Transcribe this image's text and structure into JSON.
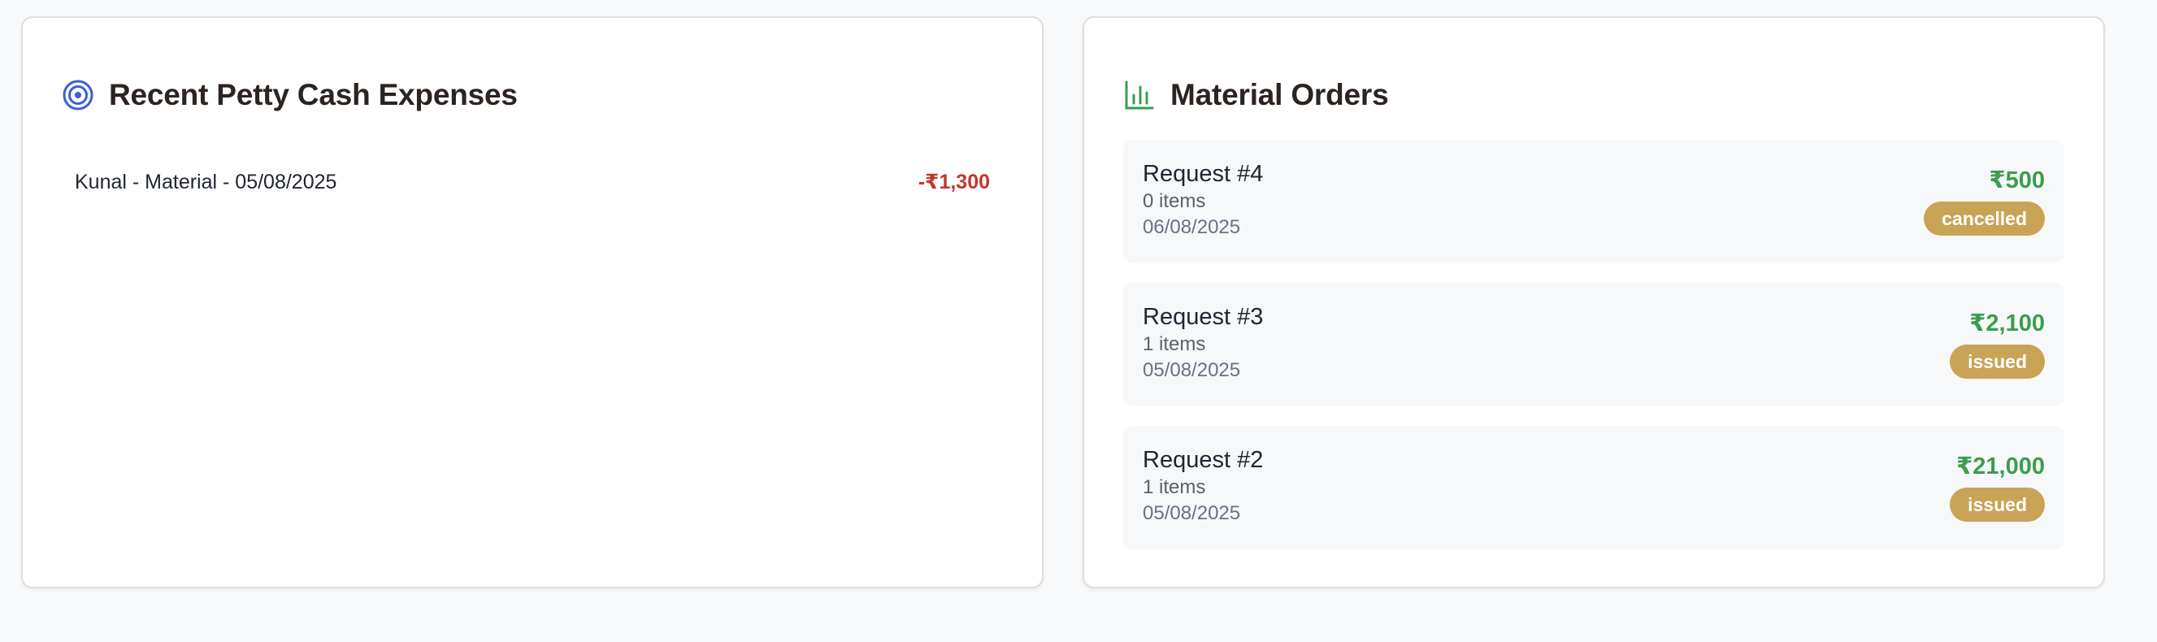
{
  "expenses_card": {
    "title": "Recent Petty Cash Expenses",
    "icon": "target-icon",
    "icon_color": "#3b5fd9",
    "items": [
      {
        "label": "Kunal - Material - 05/08/2025",
        "amount": "-₹1,300"
      }
    ]
  },
  "orders_card": {
    "title": "Material Orders",
    "icon": "bar-chart-icon",
    "icon_color": "#3a9d4f",
    "orders": [
      {
        "title": "Request #4",
        "items": "0 items",
        "date": "06/08/2025",
        "amount": "₹500",
        "status": "cancelled"
      },
      {
        "title": "Request #3",
        "items": "1 items",
        "date": "05/08/2025",
        "amount": "₹2,100",
        "status": "issued"
      },
      {
        "title": "Request #2",
        "items": "1 items",
        "date": "05/08/2025",
        "amount": "₹21,000",
        "status": "issued"
      }
    ]
  },
  "colors": {
    "expense_amount": "#c0392b",
    "order_amount": "#3a9d4f",
    "status_badge": "#c9a356"
  }
}
